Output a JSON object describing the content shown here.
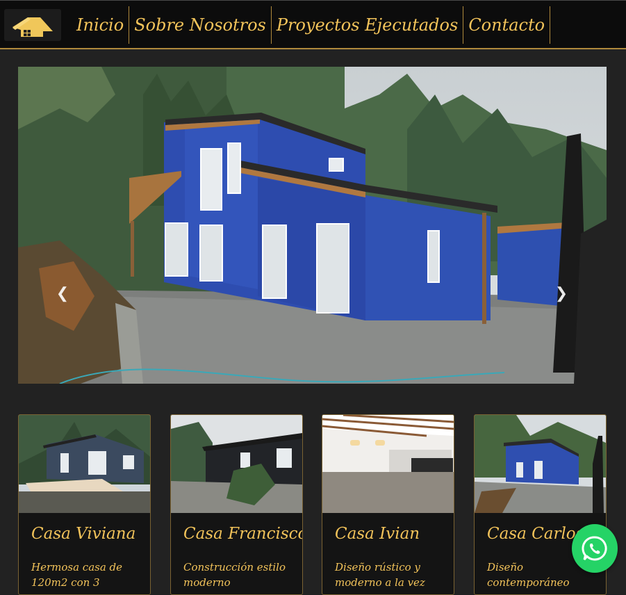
{
  "brand": {
    "logo_icon": "house-icon",
    "accent": "#f2c35a",
    "border": "#b08a3c",
    "background": "#222222"
  },
  "nav": {
    "items": [
      {
        "label": "Inicio"
      },
      {
        "label": "Sobre Nosotros"
      },
      {
        "label": "Proyectos Ejecutados"
      },
      {
        "label": "Contacto"
      }
    ]
  },
  "carousel": {
    "prev_icon": "chevron-left-icon",
    "next_icon": "chevron-right-icon",
    "prev_symbol": "❮",
    "next_symbol": "❯",
    "slide_count": 4,
    "active_index": 3
  },
  "projects": [
    {
      "title": "Casa Viviana",
      "text": "Hermosa casa de 120m2 con 3"
    },
    {
      "title": "Casa Francisco",
      "text": "Construcción estilo moderno"
    },
    {
      "title": "Casa Ivian",
      "text": "Diseño rústico y moderno a la vez"
    },
    {
      "title": "Casa Carlos",
      "text": "Diseño contemporáneo"
    }
  ],
  "whatsapp": {
    "icon": "whatsapp-icon",
    "color": "#25d366"
  }
}
